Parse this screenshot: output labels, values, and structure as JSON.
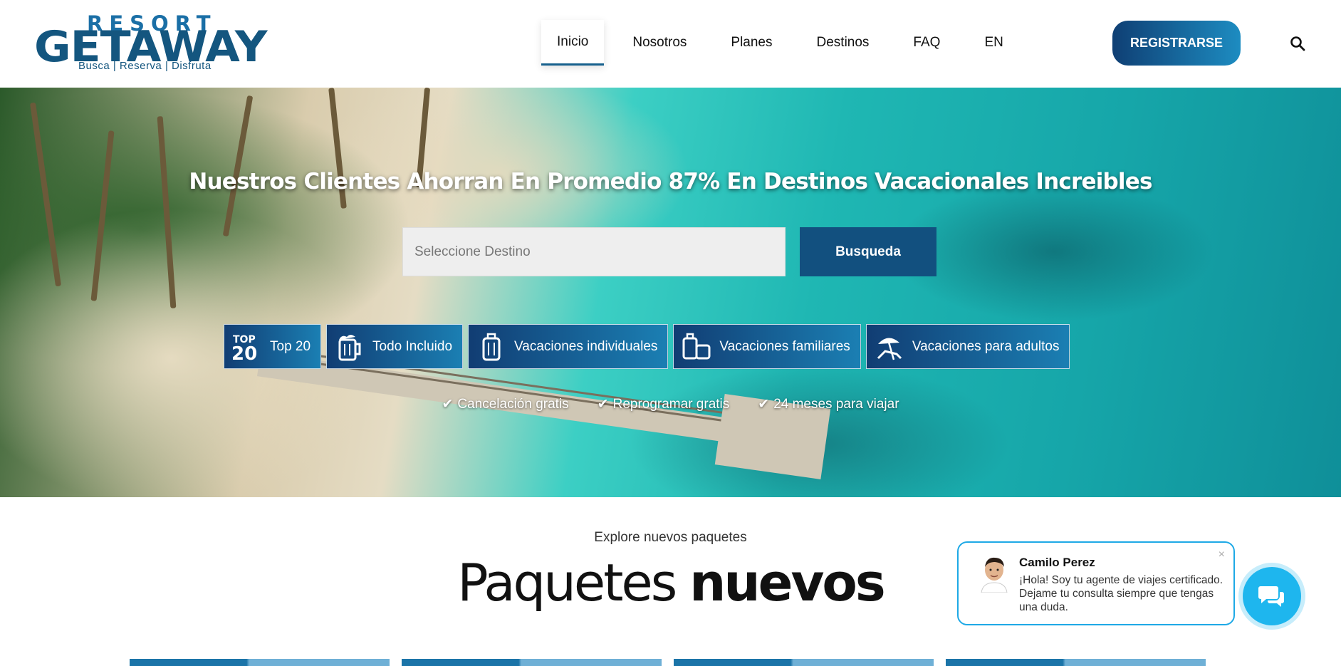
{
  "logo": {
    "top": "RESORT",
    "main": "GETAWAY",
    "tagline": "Busca | Reserva | Disfruta"
  },
  "nav": {
    "items": [
      "Inicio",
      "Nosotros",
      "Planes",
      "Destinos",
      "FAQ",
      "EN"
    ],
    "active_index": 0
  },
  "header": {
    "register_label": "REGISTRARSE"
  },
  "hero": {
    "title": "Nuestros Clientes Ahorran En Promedio 87% En Destinos Vacacionales Increibles",
    "destination_placeholder": "Seleccione Destino",
    "search_label": "Busqueda",
    "categories": [
      {
        "label": "Top 20",
        "icon": "top20-icon"
      },
      {
        "label": "Todo Incluido",
        "icon": "beer-mug-icon"
      },
      {
        "label": "Vacaciones individuales",
        "icon": "suitcase-icon"
      },
      {
        "label": "Vacaciones familiares",
        "icon": "luggage-icon"
      },
      {
        "label": "Vacaciones para adultos",
        "icon": "beach-chair-icon"
      }
    ],
    "perks": [
      "Cancelación gratis",
      "Reprogramar gratis",
      "24 meses para viajar"
    ]
  },
  "section": {
    "eyebrow": "Explore nuevos paquetes",
    "title_plain": "Paquetes",
    "title_bold": "nuevos"
  },
  "chat": {
    "agent_name": "Camilo Perez",
    "message": "¡Hola! Soy tu agente de viajes certificado. Dejame tu consulta siempre que tengas una duda.",
    "close": "×"
  },
  "colors": {
    "primary": "#12507f",
    "accent": "#1eb6ee",
    "logo_blue": "#14567f"
  }
}
